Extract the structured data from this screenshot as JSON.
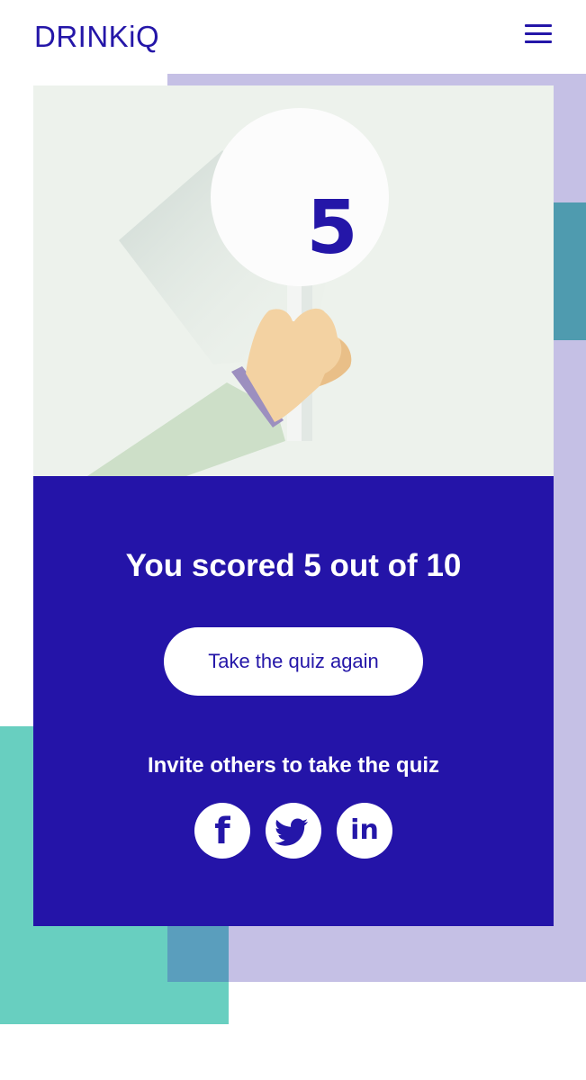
{
  "header": {
    "logo_text": "DRINKiQ",
    "menu_icon": "hamburger-menu-icon"
  },
  "illustration": {
    "score_value": "5",
    "description_icon": "hand-holding-score-sign"
  },
  "result": {
    "title": "You scored 5 out of 10",
    "retake_label": "Take the quiz again",
    "invite_text": "Invite others to take the quiz",
    "socials": [
      {
        "name": "facebook",
        "glyph": "f",
        "icon": "facebook-icon"
      },
      {
        "name": "twitter",
        "glyph": "",
        "icon": "twitter-icon"
      },
      {
        "name": "linkedin",
        "glyph": "in",
        "icon": "linkedin-icon"
      }
    ]
  },
  "colors": {
    "brand_primary": "#2416a8",
    "lavender": "#c5c0e5",
    "teal": "#68cfc0",
    "panel_bg": "#edf2ec"
  }
}
